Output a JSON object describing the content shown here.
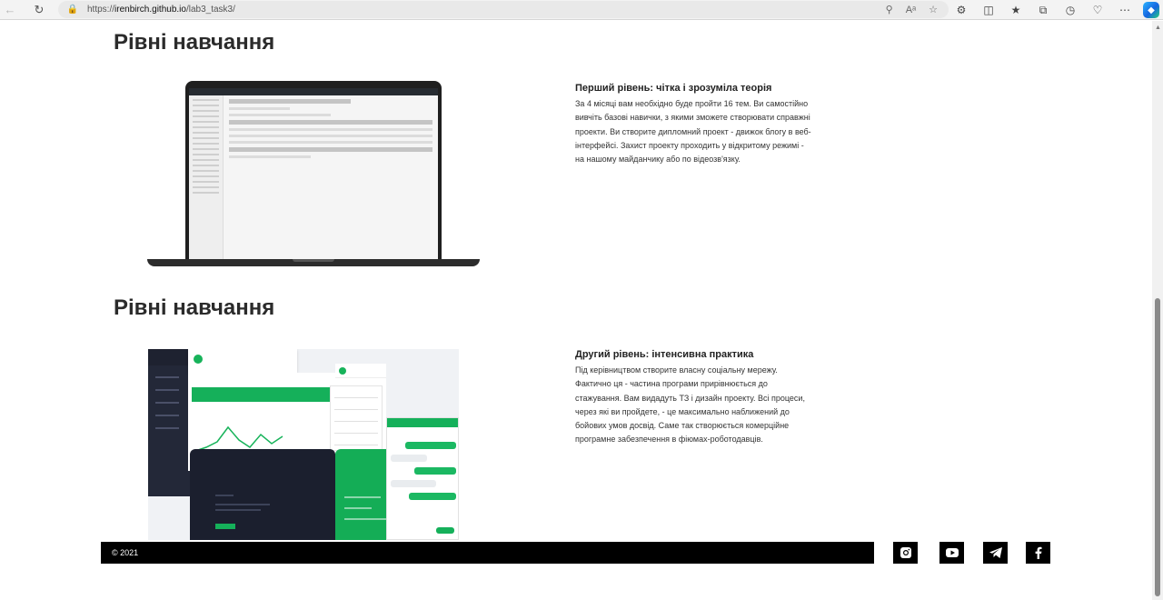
{
  "browser": {
    "url_prefix": "https://",
    "url_host": "irenbirch.github.io",
    "url_path": "/lab3_task3/"
  },
  "sections": [
    {
      "heading": "Рівні навчання",
      "level_title": "Перший рівень: чітка і зрозуміла теорія",
      "level_text": "За 4 місяці вам необхідно буде пройти 16 тем. Ви самостійно вивчіть базові навички, з якими зможете створювати справжні проекти. Ви створите дипломний проект - движок блогу в веб-інтерфейсі. Захист проекту проходить у відкритому режимі - на нашому майданчику або по відеозв'язку."
    },
    {
      "heading": "Рівні навчання",
      "level_title": "Другий рівень: інтенсивна практика",
      "level_text": "Під керівництвом створите власну соціальну мережу. Фактично ця - частина програми прирівнюється до стажування. Вам видадуть ТЗ і дизайн проекту. Всі процеси, через які ви пройдете, - це максимально наближений до бойових умов досвід. Саме так створюється комерційне програмне забезпечення в фіюмах-роботодавців."
    }
  ],
  "footer": {
    "copyright": "© 2021",
    "social_icons": [
      "instagram-icon",
      "youtube-icon",
      "telegram-icon",
      "facebook-icon"
    ]
  },
  "colors": {
    "accent_green": "#15b05a",
    "footer_bg": "#000000",
    "heading": "#2b2b2b"
  }
}
